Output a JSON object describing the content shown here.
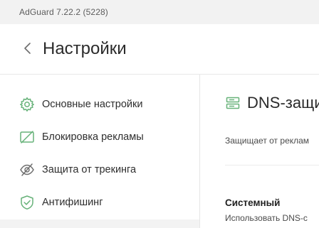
{
  "window": {
    "title": "AdGuard 7.22.2 (5228)"
  },
  "header": {
    "back_icon": "chevron-left-icon",
    "title": "Настройки"
  },
  "sidebar": {
    "items": [
      {
        "label": "Основные настройки",
        "icon": "gear-icon"
      },
      {
        "label": "Блокировка рекламы",
        "icon": "ad-block-icon"
      },
      {
        "label": "Защита от трекинга",
        "icon": "eye-off-icon"
      },
      {
        "label": "Антифишинг",
        "icon": "shield-check-icon"
      }
    ]
  },
  "content": {
    "icon": "dns-server-icon",
    "title": "DNS-защи",
    "description": "Защищает от реклам",
    "section_title": "Системный",
    "section_subtitle": "Использовать DNS-с"
  },
  "colors": {
    "accent": "#67b279",
    "text": "#2b2b2b",
    "muted": "#5d5d5d"
  }
}
